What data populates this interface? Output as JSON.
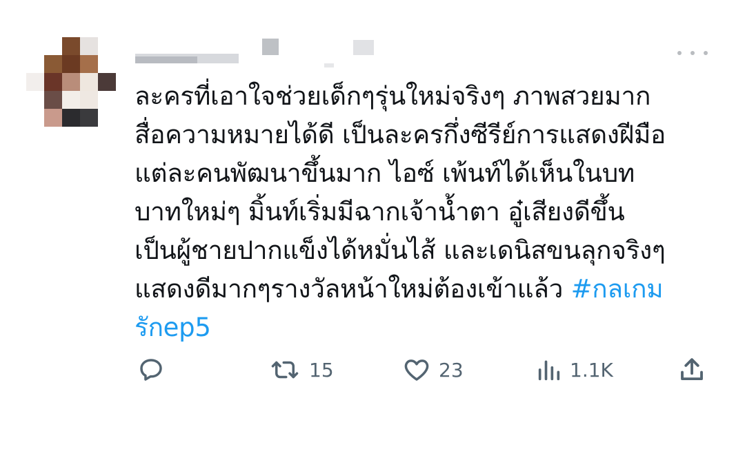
{
  "tweet": {
    "lines": [
      "ละครที่เอาใจช่วยเด็กๆรุ่นใหม่จริงๆ ภาพสวยมาก",
      "สื่อความหมายได้ดี เป็นละครกึ่งซีรีย์การแสดงฝีมือ",
      "แต่ละคนพัฒนาขึ้นมาก ไอซ์ เพ้นท์ได้เห็นในบท",
      "บาทใหม่ๆ มิ้นท์เริ่มมีฉากเจ้าน้ำตา  อู๋เสียงดีขึ้น",
      "เป็นผู้ชายปากแข็งได้หมั่นไส้ และเดนิสขนลุกจริงๆ"
    ],
    "last_line_text": "แสดงดีมากๆรางวัลหน้าใหม่ต้องเข้าแล้ว ",
    "hashtag_part1": "#กลเกม",
    "hashtag_part2": "รักep5",
    "hashtag_color": "#1d9bf0"
  },
  "actions": {
    "reply_icon": "reply-bubble-icon",
    "retweet_icon": "retweet-icon",
    "retweet_count": "15",
    "like_icon": "heart-icon",
    "like_count": "23",
    "views_icon": "views-bar-chart-icon",
    "views_count": "1.1K",
    "share_icon": "share-upload-icon",
    "icon_color": "#536471"
  },
  "more_menu_icon": "more-dots-icon"
}
